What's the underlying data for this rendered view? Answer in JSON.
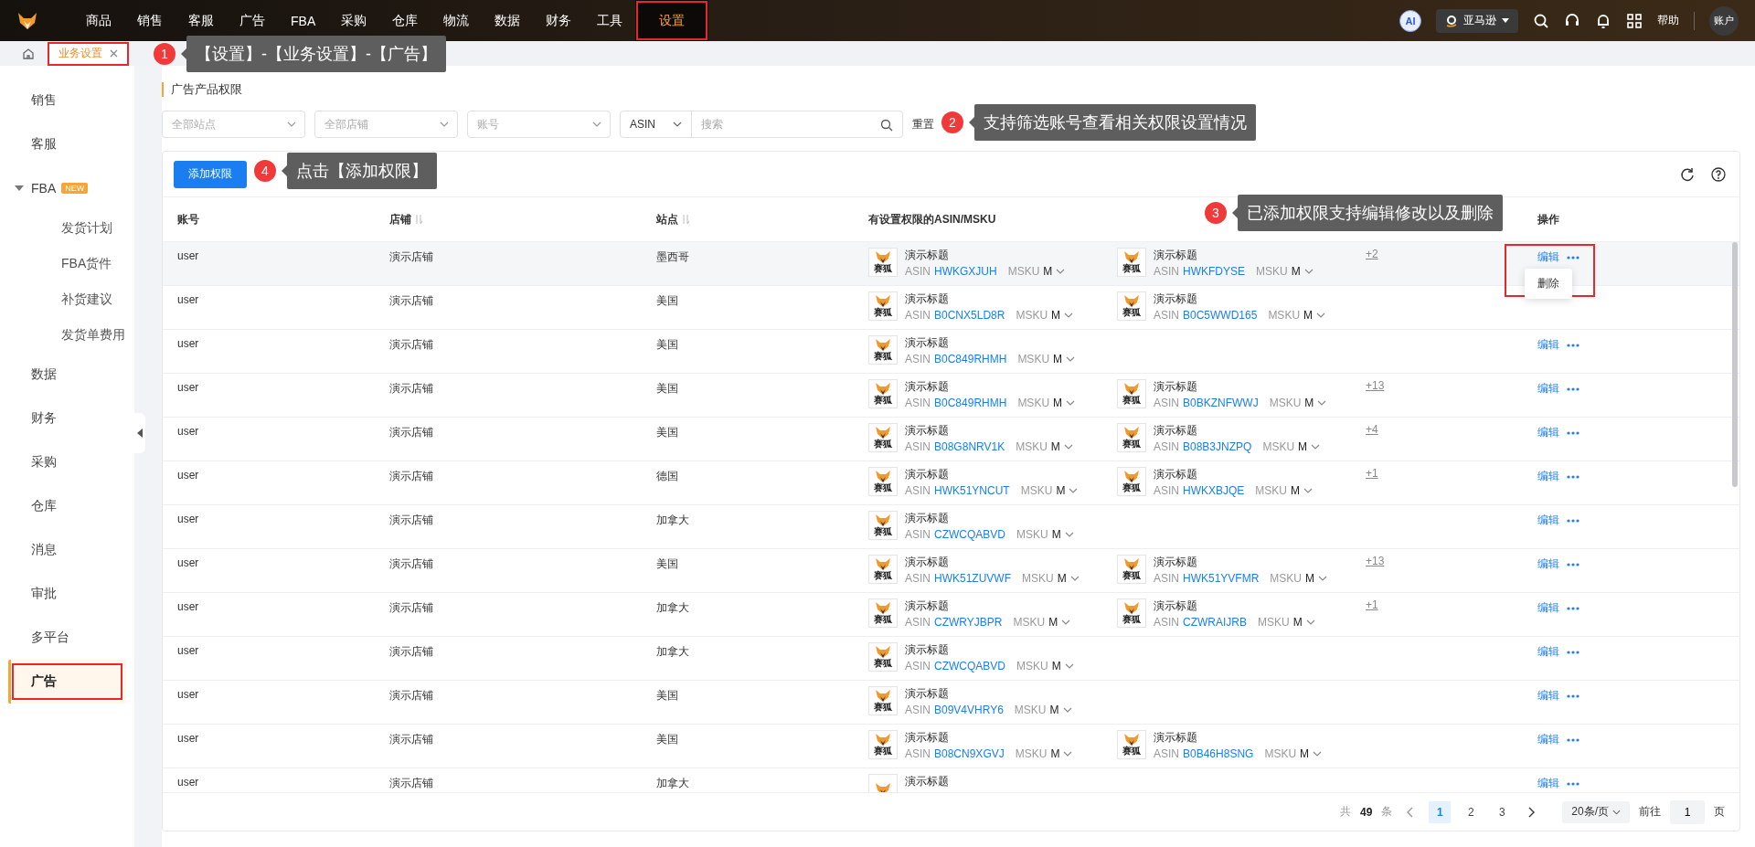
{
  "top_nav": {
    "items": [
      {
        "label": "商品",
        "selected": false,
        "highlighted": false
      },
      {
        "label": "销售",
        "selected": false,
        "highlighted": false
      },
      {
        "label": "客服",
        "selected": false,
        "highlighted": false
      },
      {
        "label": "广告",
        "selected": false,
        "highlighted": false
      },
      {
        "label": "FBA",
        "selected": false,
        "highlighted": false
      },
      {
        "label": "采购",
        "selected": false,
        "highlighted": false
      },
      {
        "label": "仓库",
        "selected": false,
        "highlighted": false
      },
      {
        "label": "物流",
        "selected": false,
        "highlighted": false
      },
      {
        "label": "数据",
        "selected": false,
        "highlighted": false
      },
      {
        "label": "财务",
        "selected": false,
        "highlighted": false
      },
      {
        "label": "工具",
        "selected": false,
        "highlighted": false
      },
      {
        "label": "设置",
        "selected": true,
        "highlighted": true
      }
    ],
    "ai_badge": "AI",
    "store": "亚马逊",
    "help": "帮助",
    "account": "账户"
  },
  "tabs": [
    {
      "label": "业务设置",
      "selected": true,
      "highlighted": true
    }
  ],
  "sidebar": {
    "items": [
      {
        "label": "销售",
        "selected": false,
        "highlighted": false
      },
      {
        "label": "客服",
        "selected": false,
        "highlighted": false
      },
      {
        "label": "FBA",
        "badge": "NEW",
        "expanded": true,
        "selected": false,
        "highlighted": false,
        "children": [
          {
            "label": "发货计划",
            "selected": false
          },
          {
            "label": "FBA货件",
            "selected": false
          },
          {
            "label": "补货建议",
            "selected": false
          },
          {
            "label": "发货单费用",
            "selected": false
          }
        ]
      },
      {
        "label": "数据",
        "selected": false,
        "highlighted": false
      },
      {
        "label": "财务",
        "selected": false,
        "highlighted": false
      },
      {
        "label": "采购",
        "selected": false,
        "highlighted": false
      },
      {
        "label": "仓库",
        "selected": false,
        "highlighted": false
      },
      {
        "label": "消息",
        "selected": false,
        "highlighted": false
      },
      {
        "label": "审批",
        "selected": false,
        "highlighted": false
      },
      {
        "label": "多平台",
        "selected": false,
        "highlighted": false
      },
      {
        "label": "广告",
        "selected": true,
        "highlighted": true
      }
    ]
  },
  "page_title": "广告产品权限",
  "filters": {
    "site": {
      "placeholder": "全部站点"
    },
    "shop": {
      "placeholder": "全部店铺"
    },
    "account": {
      "placeholder": "账号"
    },
    "search_type": "ASIN",
    "search": {
      "placeholder": "搜索"
    },
    "reset": "重置"
  },
  "toolbar": {
    "add_button": "添加权限"
  },
  "table": {
    "columns": [
      {
        "label": "账号",
        "sortable": false
      },
      {
        "label": "店铺",
        "sortable": true
      },
      {
        "label": "站点",
        "sortable": true
      },
      {
        "label": "有设置权限的ASIN/MSKU",
        "sortable": false
      },
      {
        "label": "操作",
        "sortable": false
      }
    ],
    "rows": [
      {
        "account": "user",
        "shop": "演示店铺",
        "site": "墨西哥",
        "hovered": true,
        "more": "+2",
        "edit": "编辑",
        "highlighted": true,
        "menu": [
          "删除"
        ],
        "products": [
          {
            "logo": "赛狐",
            "title": "演示标题",
            "asin_label": "ASIN",
            "asin": "HWKGXJUH",
            "msku_label": "MSKU",
            "msku": "M"
          },
          {
            "logo": "赛狐",
            "title": "演示标题",
            "asin_label": "ASIN",
            "asin": "HWKFDYSE",
            "msku_label": "MSKU",
            "msku": "M"
          }
        ]
      },
      {
        "account": "user",
        "shop": "演示店铺",
        "site": "美国",
        "products": [
          {
            "logo": "赛狐",
            "title": "演示标题",
            "asin_label": "ASIN",
            "asin": "B0CNX5LD8R",
            "msku_label": "MSKU",
            "msku": "M"
          },
          {
            "logo": "赛狐",
            "title": "演示标题",
            "asin_label": "ASIN",
            "asin": "B0C5WWD165",
            "msku_label": "MSKU",
            "msku": "M"
          }
        ]
      },
      {
        "account": "user",
        "shop": "演示店铺",
        "site": "美国",
        "hovered": false,
        "edit": "编辑",
        "highlighted": false,
        "products": [
          {
            "logo": "赛狐",
            "title": "演示标题",
            "asin_label": "ASIN",
            "asin": "B0C849RHMH",
            "msku_label": "MSKU",
            "msku": "M"
          }
        ]
      },
      {
        "account": "user",
        "shop": "演示店铺",
        "site": "美国",
        "hovered": false,
        "more": "+13",
        "edit": "编辑",
        "highlighted": false,
        "products": [
          {
            "logo": "赛狐",
            "title": "演示标题",
            "asin_label": "ASIN",
            "asin": "B0C849RHMH",
            "msku_label": "MSKU",
            "msku": "M"
          },
          {
            "logo": "赛狐",
            "title": "演示标题",
            "asin_label": "ASIN",
            "asin": "B0BKZNFWWJ",
            "msku_label": "MSKU",
            "msku": "M"
          }
        ]
      },
      {
        "account": "user",
        "shop": "演示店铺",
        "site": "美国",
        "hovered": false,
        "more": "+4",
        "edit": "编辑",
        "highlighted": false,
        "products": [
          {
            "logo": "赛狐",
            "title": "演示标题",
            "asin_label": "ASIN",
            "asin": "B08G8NRV1K",
            "msku_label": "MSKU",
            "msku": "M"
          },
          {
            "logo": "赛狐",
            "title": "演示标题",
            "asin_label": "ASIN",
            "asin": "B08B3JNZPQ",
            "msku_label": "MSKU",
            "msku": "M"
          }
        ]
      },
      {
        "account": "user",
        "shop": "演示店铺",
        "site": "德国",
        "hovered": false,
        "more": "+1",
        "edit": "编辑",
        "highlighted": false,
        "products": [
          {
            "logo": "赛狐",
            "title": "演示标题",
            "asin_label": "ASIN",
            "asin": "HWK51YNCUT",
            "msku_label": "MSKU",
            "msku": "M"
          },
          {
            "logo": "赛狐",
            "title": "演示标题",
            "asin_label": "ASIN",
            "asin": "HWKXBJQE",
            "msku_label": "MSKU",
            "msku": "M"
          }
        ]
      },
      {
        "account": "user",
        "shop": "演示店铺",
        "site": "加拿大",
        "hovered": false,
        "edit": "编辑",
        "highlighted": false,
        "products": [
          {
            "logo": "赛狐",
            "title": "演示标题",
            "asin_label": "ASIN",
            "asin": "CZWCQABVD",
            "msku_label": "MSKU",
            "msku": "M"
          }
        ]
      },
      {
        "account": "user",
        "shop": "演示店铺",
        "site": "美国",
        "hovered": false,
        "more": "+13",
        "edit": "编辑",
        "highlighted": false,
        "products": [
          {
            "logo": "赛狐",
            "title": "演示标题",
            "asin_label": "ASIN",
            "asin": "HWK51ZUVWF",
            "msku_label": "MSKU",
            "msku": "M"
          },
          {
            "logo": "赛狐",
            "title": "演示标题",
            "asin_label": "ASIN",
            "asin": "HWK51YVFMR",
            "msku_label": "MSKU",
            "msku": "M"
          }
        ]
      },
      {
        "account": "user",
        "shop": "演示店铺",
        "site": "加拿大",
        "hovered": false,
        "more": "+1",
        "edit": "编辑",
        "highlighted": false,
        "products": [
          {
            "logo": "赛狐",
            "title": "演示标题",
            "asin_label": "ASIN",
            "asin": "CZWRYJBPR",
            "msku_label": "MSKU",
            "msku": "M"
          },
          {
            "logo": "赛狐",
            "title": "演示标题",
            "asin_label": "ASIN",
            "asin": "CZWRAIJRB",
            "msku_label": "MSKU",
            "msku": "M"
          }
        ]
      },
      {
        "account": "user",
        "shop": "演示店铺",
        "site": "加拿大",
        "hovered": false,
        "edit": "编辑",
        "highlighted": false,
        "products": [
          {
            "logo": "赛狐",
            "title": "演示标题",
            "asin_label": "ASIN",
            "asin": "CZWCQABVD",
            "msku_label": "MSKU",
            "msku": "M"
          }
        ]
      },
      {
        "account": "user",
        "shop": "演示店铺",
        "site": "美国",
        "hovered": false,
        "edit": "编辑",
        "highlighted": false,
        "products": [
          {
            "logo": "赛狐",
            "title": "演示标题",
            "asin_label": "ASIN",
            "asin": "B09V4VHRY6",
            "msku_label": "MSKU",
            "msku": "M"
          }
        ]
      },
      {
        "account": "user",
        "shop": "演示店铺",
        "site": "美国",
        "hovered": false,
        "edit": "编辑",
        "highlighted": false,
        "products": [
          {
            "logo": "赛狐",
            "title": "演示标题",
            "asin_label": "ASIN",
            "asin": "B08CN9XGVJ",
            "msku_label": "MSKU",
            "msku": "M"
          },
          {
            "logo": "赛狐",
            "title": "演示标题",
            "asin_label": "ASIN",
            "asin": "B0B46H8SNG",
            "msku_label": "MSKU",
            "msku": "M"
          }
        ]
      },
      {
        "account": "user",
        "shop": "演示店铺",
        "site": "加拿大",
        "hovered": false,
        "edit": "编辑",
        "highlighted": false,
        "products": [
          {
            "title": "演示标题"
          }
        ]
      }
    ]
  },
  "pagination": {
    "total_prefix": "共",
    "total": "49",
    "total_suffix": "条",
    "pages": [
      {
        "label": "1",
        "selected": true
      },
      {
        "label": "2",
        "selected": false
      },
      {
        "label": "3",
        "selected": false
      }
    ],
    "page_size": "20条/页",
    "goto_label": "前往",
    "goto_value": "1",
    "goto_suffix": "页"
  },
  "annotations": [
    {
      "number": "1",
      "text": "【设置】-【业务设置】-【广告】"
    },
    {
      "number": "2",
      "text": "支持筛选账号查看相关权限设置情况"
    },
    {
      "number": "3",
      "text": "已添加权限支持编辑修改以及删除"
    },
    {
      "number": "4",
      "text": "点击【添加权限】"
    }
  ]
}
